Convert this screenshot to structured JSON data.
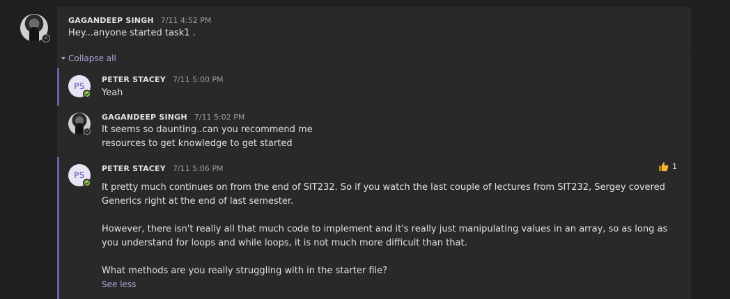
{
  "thread": {
    "root": {
      "author": "GAGANDEEP SINGH",
      "time": "7/11 4:52 PM",
      "text": "Hey...anyone started task1 ."
    },
    "collapse_label": "Collapse all",
    "replies": [
      {
        "author": "PETER STACEY",
        "initials": "PS",
        "time": "7/11 5:00 PM",
        "lines": [
          "Yeah"
        ]
      },
      {
        "author": "GAGANDEEP SINGH",
        "time": "7/11 5:02 PM",
        "lines": [
          "It seems so daunting..can you recommend me",
          "resources to get knowledge to get started"
        ]
      },
      {
        "author": "PETER STACEY",
        "initials": "PS",
        "time": "7/11 5:06 PM",
        "reaction_count": "1",
        "paragraphs": [
          "It pretty much continues on from the end of SIT232. So if you watch the last couple of lectures from SIT232, Sergey covered Generics right at the end of last semester.",
          "However, there isn't really all that much code to implement and it's really just manipulating values in an array, so as long as you understand for loops and while loops, it is not much more difficult than that.",
          "What methods are you really struggling with in the starter file?"
        ],
        "see_less_label": "See less"
      }
    ]
  },
  "colors": {
    "accent": "#6264a7",
    "link": "#a6a7dc",
    "available": "#92c353"
  }
}
